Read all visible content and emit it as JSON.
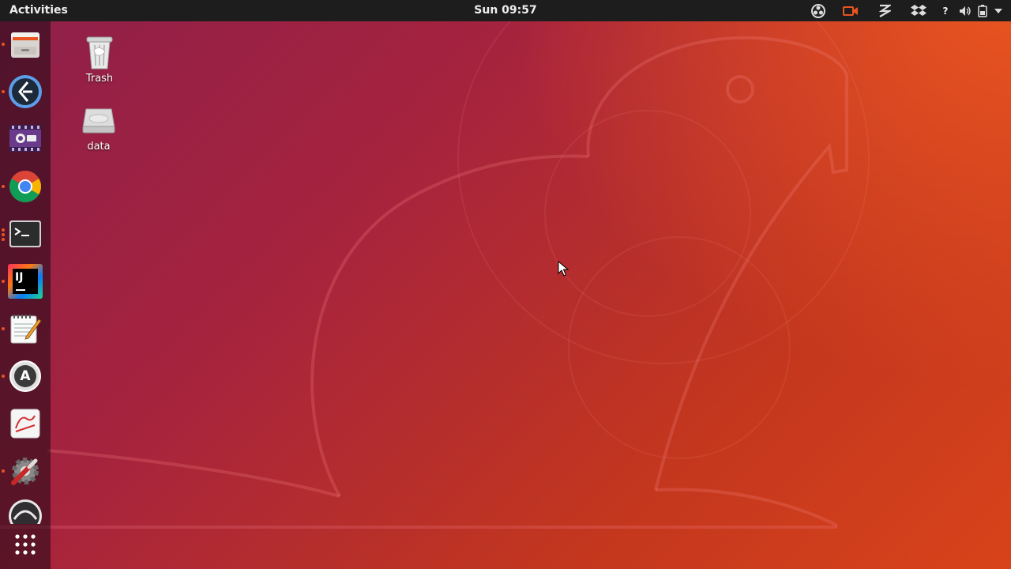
{
  "topbar": {
    "activities_label": "Activities",
    "clock": "Sun 09:57",
    "tray": [
      "obs-icon",
      "camera-icon",
      "zeal-icon",
      "dropbox-icon",
      "help-icon",
      "volume-icon",
      "battery-icon",
      "system-menu-arrow-icon"
    ]
  },
  "dock": {
    "items": [
      {
        "name": "files",
        "icon": "file-manager-icon"
      },
      {
        "name": "kdeconnect",
        "icon": "kde-connect-icon"
      },
      {
        "name": "video-editor",
        "icon": "video-editor-icon"
      },
      {
        "name": "chrome",
        "icon": "chrome-icon"
      },
      {
        "name": "terminal",
        "icon": "terminal-icon"
      },
      {
        "name": "intellij",
        "icon": "intellij-icon",
        "text": "IJ"
      },
      {
        "name": "text-editor",
        "icon": "text-editor-icon"
      },
      {
        "name": "software-updater",
        "icon": "software-updater-icon",
        "text": "A"
      },
      {
        "name": "document-viewer",
        "icon": "document-viewer-icon"
      },
      {
        "name": "settings",
        "icon": "settings-icon"
      },
      {
        "name": "obs",
        "icon": "obs-studio-icon"
      }
    ],
    "show_apps_icon": "show-applications-icon"
  },
  "desktop": {
    "icons": [
      {
        "label": "Trash",
        "icon": "trash-icon"
      },
      {
        "label": "data",
        "icon": "drive-icon"
      }
    ]
  },
  "colors": {
    "accent": "#e95420",
    "topbar_bg": "#1d1d1d",
    "wallpaper_start": "#8e1f4a",
    "wallpaper_end": "#e95420"
  }
}
